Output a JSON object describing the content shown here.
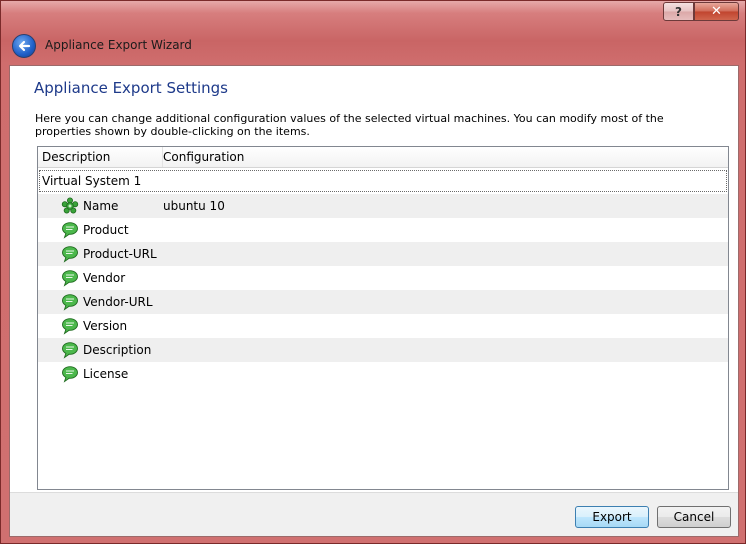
{
  "window": {
    "title": "Appliance Export Wizard",
    "help_label": "?",
    "close_label": "✕"
  },
  "page": {
    "title": "Appliance Export Settings",
    "description": "Here you can change additional configuration values of the selected virtual machines. You can modify most of the properties shown by double-clicking on the items."
  },
  "table": {
    "columns": [
      "Description",
      "Configuration"
    ],
    "group": "Virtual System 1",
    "rows": [
      {
        "label": "Name",
        "value": "ubuntu 10",
        "icon": "name-gear-icon"
      },
      {
        "label": "Product",
        "value": "",
        "icon": "speech-bubble-icon"
      },
      {
        "label": "Product-URL",
        "value": "",
        "icon": "speech-bubble-icon"
      },
      {
        "label": "Vendor",
        "value": "",
        "icon": "speech-bubble-icon"
      },
      {
        "label": "Vendor-URL",
        "value": "",
        "icon": "speech-bubble-icon"
      },
      {
        "label": "Version",
        "value": "",
        "icon": "speech-bubble-icon"
      },
      {
        "label": "Description",
        "value": "",
        "icon": "speech-bubble-icon"
      },
      {
        "label": "License",
        "value": "",
        "icon": "speech-bubble-icon"
      }
    ]
  },
  "buttons": {
    "export": "Export",
    "cancel": "Cancel"
  },
  "colors": {
    "title_accent": "#1e3a8a",
    "frame": "#cf6d6d",
    "icon_green": "#3aa33a"
  }
}
